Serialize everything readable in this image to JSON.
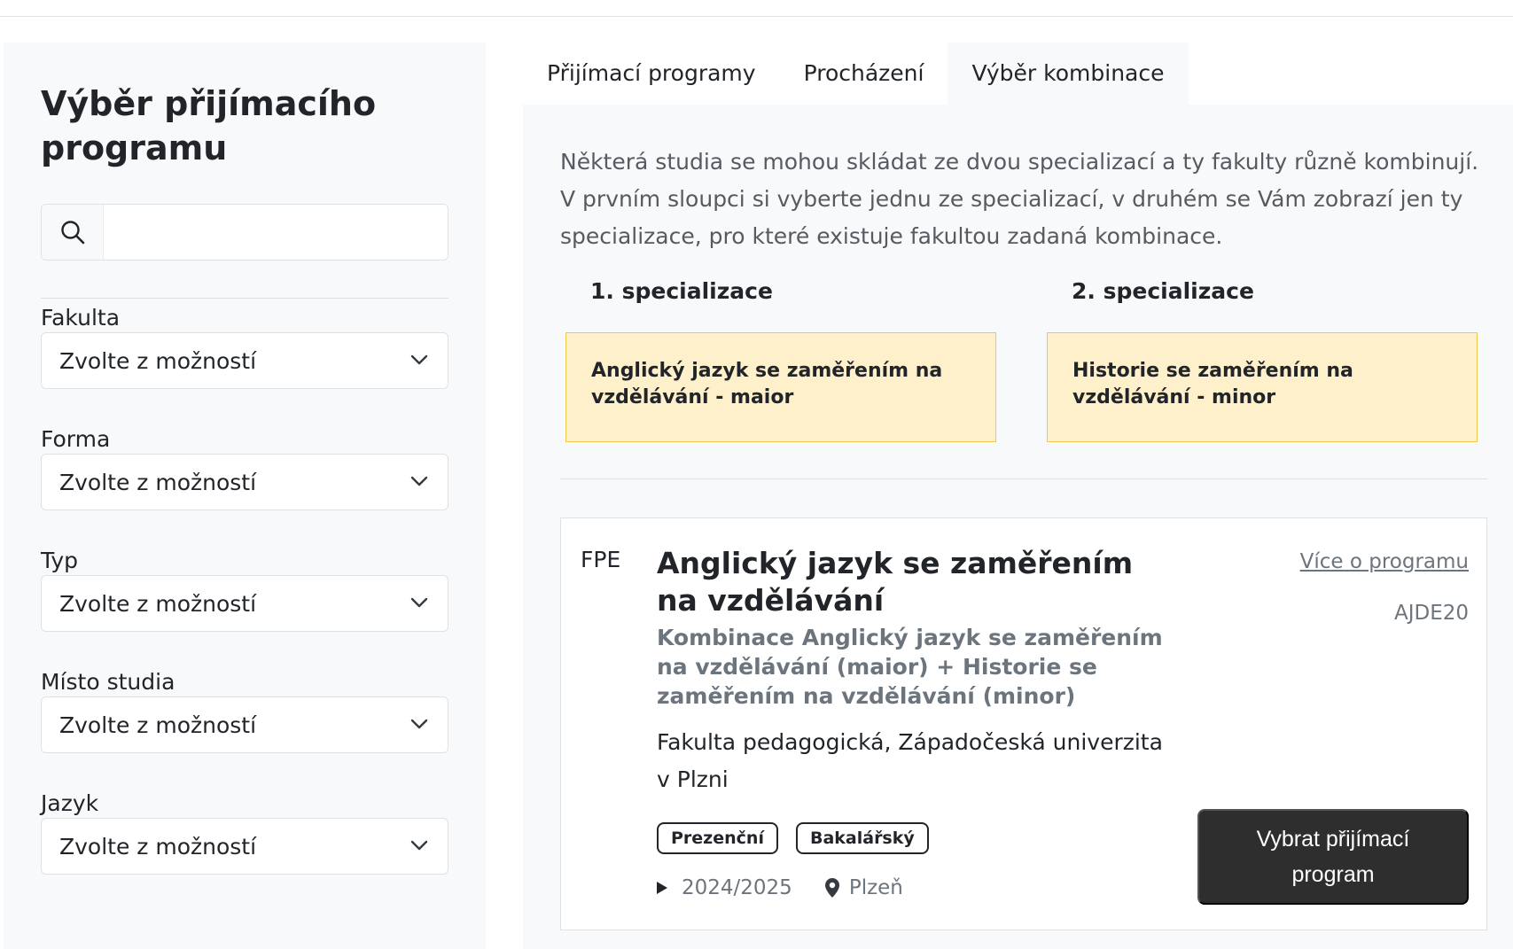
{
  "sidebar": {
    "title": "Výběr přijímacího programu",
    "search": {
      "value": "",
      "placeholder": ""
    },
    "filters": [
      {
        "label": "Fakulta",
        "value": "Zvolte z možností"
      },
      {
        "label": "Forma",
        "value": "Zvolte z možností"
      },
      {
        "label": "Typ",
        "value": "Zvolte z možností"
      },
      {
        "label": "Místo studia",
        "value": "Zvolte z možností"
      },
      {
        "label": "Jazyk",
        "value": "Zvolte z možností"
      }
    ]
  },
  "tabs": [
    {
      "label": "Přijímací programy",
      "active": false
    },
    {
      "label": "Procházení",
      "active": false
    },
    {
      "label": "Výběr kombinace",
      "active": true
    }
  ],
  "main": {
    "intro": "Některá studia se mohou skládat ze dvou specializací a ty fakulty různě kombinují. V prvním sloupci si vyberte jednu ze specializací, v druhém se Vám zobrazí jen ty specializace, pro které existuje fakultou zadaná kombinace.",
    "spec1": {
      "label": "1. specializace",
      "selected": "Anglický jazyk se zaměřením na vzdělávání - maior"
    },
    "spec2": {
      "label": "2. specializace",
      "selected": "Historie se zaměřením na vzdělávání - minor"
    },
    "card": {
      "faculty_code": "FPE",
      "title": "Anglický jazyk se zaměřením na vzdělávání",
      "subtitle": "Kombinace Anglický jazyk se zaměřením na vzdělávání (maior) + Historie se zaměřením na vzdělávání (minor)",
      "faculty": "Fakulta pedagogická, Západočeská univerzita v Plzni",
      "more_link": "Více o programu",
      "code": "AJDE20",
      "badges": [
        "Prezenční",
        "Bakalářský"
      ],
      "year": "2024/2025",
      "location": "Plzeň",
      "select_button": "Vybrat přijímací program"
    }
  },
  "colors": {
    "sidebar_bg": "#f8f9fa",
    "spec_box_bg": "#fff0cc",
    "spec_box_border": "#f0c948",
    "primary_button": "#2e2e2e"
  },
  "icons": {
    "search": "search-icon",
    "dropdown": "chevron-down-icon",
    "year": "triangle-right-icon",
    "location": "map-pin-icon"
  }
}
